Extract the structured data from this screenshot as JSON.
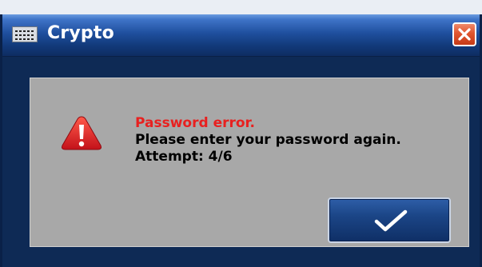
{
  "window": {
    "title": "Crypto",
    "icon": "keyboard-icon",
    "close_icon": "close-icon"
  },
  "dialog": {
    "icon": "warning-icon",
    "error_title": "Password error.",
    "message_line": "Please enter your password again.",
    "attempt_text": "Attempt: 4/6",
    "ok_icon": "checkmark-icon"
  },
  "colors": {
    "title_bar": "#1f4f9e",
    "window_body": "#0e2a55",
    "panel": "#a8a8a8",
    "error_text": "#e8201f",
    "close_button": "#e0552e",
    "ok_button": "#1b4586"
  }
}
